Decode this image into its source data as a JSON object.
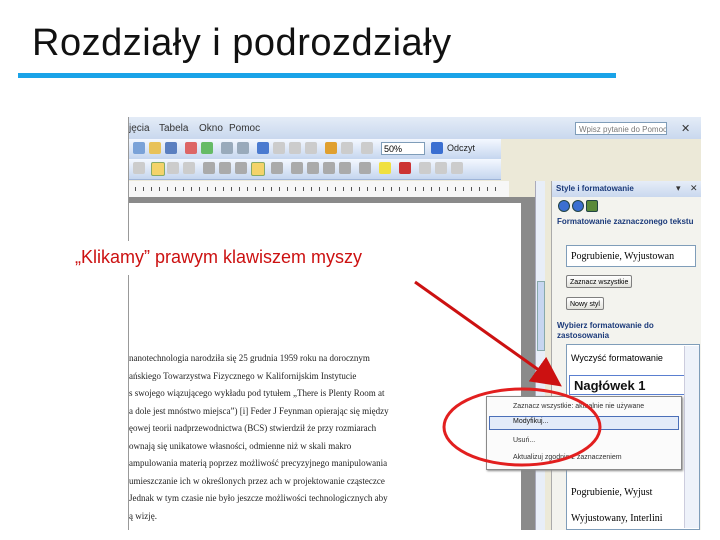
{
  "slide": {
    "title": "Rozdziały i podrozdziały",
    "callout": "„Klikamy” prawym klawiszem myszy",
    "accent_color": "#1aa3e8",
    "arrow_color": "#cc1111"
  },
  "menubar": {
    "items": [
      "jęcia",
      "Tabela",
      "Okno",
      "Pomoc"
    ],
    "ask_placeholder": "Wpisz pytanie do Pomocy",
    "close_icon": "x-icon"
  },
  "toolbar": {
    "zoom": "50%",
    "read_button": "Odczyt"
  },
  "document": {
    "lines": [
      "nanotechnologia narodziła się 25 grudnia 1959 roku na dorocznym",
      "ańskiego Towarzystwa Fizycznego w Kalifornijskim Instytucie",
      "s swojego wiązującego wykładu pod tytułem „There is Plenty Room at",
      "a dole jest mnóstwo miejsca”) [i] Feder J Feynman opierając się między",
      "ęowej teorii nadprzewodnictwa (BCS) stwierdził że przy rozmiarach",
      "ownają się unikatowe własności, odmienne niż w skali makro",
      "ampulowania materią poprzez możliwość precyzyjnego manipulowania",
      "umieszczanie ich w określonych przez ach w projektowanie cząsteczce",
      "Jednak w tym czasie nie było jeszcze możliwości technologicznych aby",
      "ą wizję."
    ]
  },
  "task_pane": {
    "title": "Style i formatowanie",
    "selected_text_label": "Formatowanie zaznaczonego tekstu",
    "current_format": "Pogrubienie, Wyjustowan",
    "select_all_button": "Zaznacz wszystkie",
    "new_style_button": "Nowy styl",
    "apply_label": "Wybierz formatowanie do zastosowania",
    "list": {
      "clear": "Wyczyść formatowanie",
      "heading": "Nagłówek 1",
      "item_bold": "Pogrubienie, Wyjust",
      "item_justified": "Wyjustowany, Interlini"
    }
  },
  "context_menu": {
    "items": [
      "Zaznacz wszystkie: aktualnie nie używane",
      "Modyfikuj...",
      "Usuń...",
      "Aktualizuj zgodnie z zaznaczeniem"
    ]
  }
}
